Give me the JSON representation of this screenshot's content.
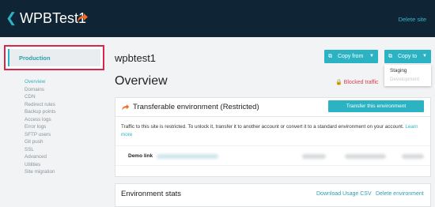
{
  "header": {
    "back_icon": "chevron-left-icon",
    "title": "WPBTest1",
    "flame_icon": "transfer-flame-icon",
    "delete_site": "Delete site"
  },
  "sidebar": {
    "environment": "Production",
    "items": [
      {
        "label": "Overview",
        "active": true
      },
      {
        "label": "Domains"
      },
      {
        "label": "CDN"
      },
      {
        "label": "Redirect rules"
      },
      {
        "label": "Backup points"
      },
      {
        "label": "Access logs"
      },
      {
        "label": "Error logs"
      },
      {
        "label": "SFTP users"
      },
      {
        "label": "Git push"
      },
      {
        "label": "SSL"
      },
      {
        "label": "Advanced"
      },
      {
        "label": "Utilities"
      },
      {
        "label": "Site migration"
      }
    ]
  },
  "main": {
    "env_name": "wpbtest1",
    "copy_from": "Copy from",
    "copy_to": "Copy to",
    "dropdown": [
      "Staging",
      "Development"
    ],
    "overview": "Overview",
    "blocked": "Blocked traffic",
    "transferable": {
      "title": "Transferable environment (Restricted)",
      "button": "Transfer this environment",
      "text": "Traffic to this site is restricted. To unlock it, transfer it to another account or convert it to a standard environment on your account.",
      "learn_more": "Learn more",
      "demo_label": "Demo link"
    },
    "stats": {
      "title": "Environment stats",
      "download": "Download Usage CSV",
      "delete_env": "Delete environment"
    }
  },
  "colors": {
    "accent": "#2bb3c4",
    "header_bg": "#0f2434",
    "highlight": "#d8274a",
    "flame": "#f26d21"
  }
}
